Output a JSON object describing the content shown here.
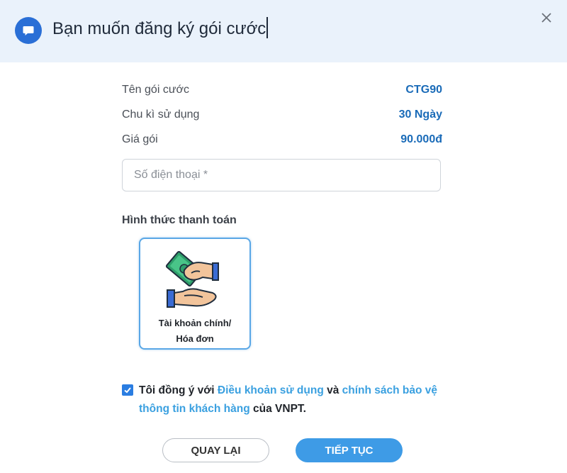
{
  "header": {
    "title": "Bạn muốn đăng ký gói cước",
    "icon": "chat-bubble-icon",
    "close_icon": "close-icon"
  },
  "package": {
    "rows": [
      {
        "label": "Tên gói cước",
        "value": "CTG90"
      },
      {
        "label": "Chu kì sử dụng",
        "value": "30 Ngày"
      },
      {
        "label": "Giá gói",
        "value": "90.000đ"
      }
    ]
  },
  "phone": {
    "placeholder": "Số điện thoại *",
    "value": ""
  },
  "payment": {
    "title": "Hình thức thanh toán",
    "options": [
      {
        "line1": "Tài khoản chính/",
        "line2": "Hóa đơn",
        "icon": "money-hands-icon",
        "selected": true
      }
    ]
  },
  "agreement": {
    "checked": true,
    "prefix": "Tôi đồng ý với ",
    "terms_link": "Điều khoản sử dụng",
    "middle": " và ",
    "privacy_link": "chính sách bảo vệ thông tin khách hàng",
    "suffix": " của VNPT."
  },
  "buttons": {
    "back": "QUAY LẠI",
    "next": "TIẾP TỤC"
  },
  "colors": {
    "header_bg": "#eaf2fb",
    "accent": "#2a6fd6",
    "value_text": "#1a6bb8",
    "link": "#3aa0e0",
    "primary_button": "#3e9be6"
  }
}
